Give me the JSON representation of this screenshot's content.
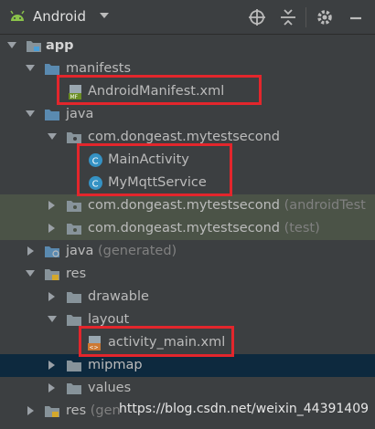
{
  "toolbar": {
    "title": "Android",
    "icons": [
      "android-icon",
      "chevron-down-icon",
      "target-icon",
      "collapse-icon",
      "gear-icon",
      "minimize-icon"
    ]
  },
  "tree": {
    "app": "app",
    "manifests": "manifests",
    "android_manifest": "AndroidManifest.xml",
    "java": "java",
    "package_main": "com.dongeast.mytestsecond",
    "main_activity": "MainActivity",
    "mqtt_service": "MyMqttService",
    "package_android_test": "com.dongeast.mytestsecond",
    "android_test_suffix": "(androidTest",
    "package_test": "com.dongeast.mytestsecond",
    "test_suffix": "(test)",
    "java_generated": "java",
    "generated_suffix": "(generated)",
    "res": "res",
    "drawable": "drawable",
    "layout": "layout",
    "activity_main": "activity_main.xml",
    "mipmap": "mipmap",
    "values": "values",
    "res_generated": "res",
    "res_generated_suffix": "(gen"
  },
  "watermark": "https://blog.csdn.net/weixin_44391409",
  "colors": {
    "background": "#3c3f41",
    "highlight_box": "#e3262c",
    "selected_row": "#0d293e",
    "test_row": "#4b5347",
    "class_icon": "#3592c4",
    "folder": "#87939a"
  }
}
